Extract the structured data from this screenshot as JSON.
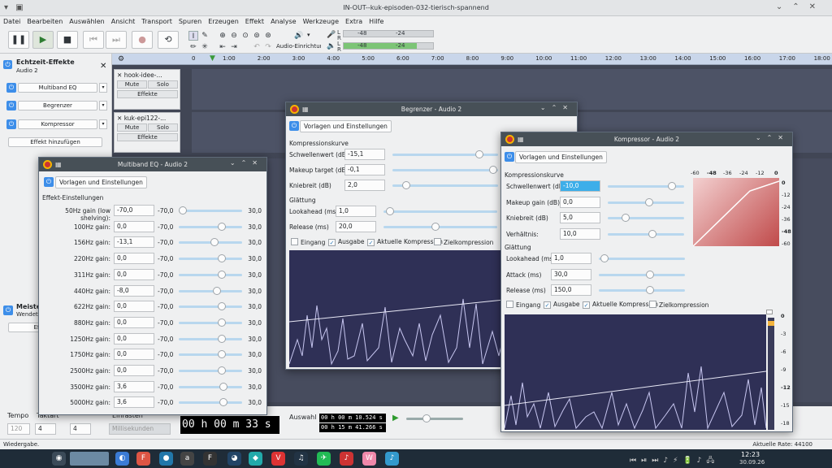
{
  "window": {
    "title": "IN-OUT--kuk-episoden-032-tierisch-spannend"
  },
  "menu": [
    "Datei",
    "Bearbeiten",
    "Auswählen",
    "Ansicht",
    "Transport",
    "Spuren",
    "Erzeugen",
    "Effekt",
    "Analyse",
    "Werkzeuge",
    "Extra",
    "Hilfe"
  ],
  "toolbar": {
    "audio_setup_label": "Audio-Einrichtung",
    "meter_rec": {
      "scale_left": "-48",
      "scale_right": "-24",
      "l": "L",
      "r": "R"
    },
    "meter_play": {
      "scale_left": "-48",
      "scale_right": "-24",
      "l": "L",
      "r": "R"
    }
  },
  "ruler": [
    "0",
    "1:00",
    "2:00",
    "3:00",
    "4:00",
    "5:00",
    "6:00",
    "7:00",
    "8:00",
    "9:00",
    "10:00",
    "11:00",
    "12:00",
    "13:00",
    "14:00",
    "15:00",
    "16:00",
    "17:00",
    "18:00"
  ],
  "tracks": [
    {
      "name": "hook-idee-...",
      "mute": "Mute",
      "solo": "Solo",
      "effects": "Effekte"
    },
    {
      "name": "kuk-epi122-...",
      "mute": "Mute",
      "solo": "Solo",
      "effects": "Effekte"
    }
  ],
  "fxpanel": {
    "title": "Echtzeit-Effekte",
    "subtitle": "Audio 2",
    "effects": [
      "Multiband EQ",
      "Begrenzer",
      "Kompressor"
    ],
    "add_label": "Effekt hinzufügen",
    "master_title": "Meiste",
    "master_sub": "Wendet",
    "master_btn": "Effe"
  },
  "selbar": {
    "tempo_label": "Tempo",
    "takt_label": "Taktart",
    "einrasten_label": "Einrasten",
    "tempo_value": "120",
    "takt_a": "4",
    "takt_b": "4",
    "snap": "Millisekunden",
    "time": "00 h 00 m 33 s",
    "auswahl_label": "Auswahl",
    "sel_start": "00 h 00 m 10.524 s",
    "sel_end": "00 h 15 m 41.266 s"
  },
  "status": {
    "left": "Wiedergabe.",
    "right": "Aktuelle Rate: 44100"
  },
  "clock": {
    "time": "12:23",
    "date": "30.09.26"
  },
  "eq_dialog": {
    "title": "Multiband EQ - Audio 2",
    "preset": "Vorlagen und Einstellungen",
    "section": "Effekt-Einstellungen",
    "params": [
      {
        "label": "50Hz gain (low shelving):",
        "value": "-70,0",
        "min": "-70,0",
        "max": "30,0",
        "pos": 0.0
      },
      {
        "label": "100Hz gain:",
        "value": "0,0",
        "min": "-70,0",
        "max": "30,0",
        "pos": 0.7
      },
      {
        "label": "156Hz gain:",
        "value": "-13,1",
        "min": "-70,0",
        "max": "30,0",
        "pos": 0.57
      },
      {
        "label": "220Hz gain:",
        "value": "0,0",
        "min": "-70,0",
        "max": "30,0",
        "pos": 0.7
      },
      {
        "label": "311Hz gain:",
        "value": "0,0",
        "min": "-70,0",
        "max": "30,0",
        "pos": 0.7
      },
      {
        "label": "440Hz gain:",
        "value": "-8,0",
        "min": "-70,0",
        "max": "30,0",
        "pos": 0.62
      },
      {
        "label": "622Hz gain:",
        "value": "0,0",
        "min": "-70,0",
        "max": "30,0",
        "pos": 0.7
      },
      {
        "label": "880Hz gain:",
        "value": "0,0",
        "min": "-70,0",
        "max": "30,0",
        "pos": 0.7
      },
      {
        "label": "1250Hz gain:",
        "value": "0,0",
        "min": "-70,0",
        "max": "30,0",
        "pos": 0.7
      },
      {
        "label": "1750Hz gain:",
        "value": "0,0",
        "min": "-70,0",
        "max": "30,0",
        "pos": 0.7
      },
      {
        "label": "2500Hz gain:",
        "value": "0,0",
        "min": "-70,0",
        "max": "30,0",
        "pos": 0.7
      },
      {
        "label": "3500Hz gain:",
        "value": "3,6",
        "min": "-70,0",
        "max": "30,0",
        "pos": 0.74
      },
      {
        "label": "5000Hz gain:",
        "value": "3,6",
        "min": "-70,0",
        "max": "30,0",
        "pos": 0.74
      }
    ]
  },
  "limiter_dialog": {
    "title": "Begrenzer - Audio 2",
    "preset": "Vorlagen und Einstellungen",
    "curve_section": "Kompressionskurve",
    "params": [
      {
        "label": "Schwellenwert (dB)",
        "value": "-15,1",
        "pos": 0.85
      },
      {
        "label": "Makeup target (dB)",
        "value": "-0,1",
        "pos": 0.99
      },
      {
        "label": "Kniebreit (dB)",
        "value": "2,0",
        "pos": 0.1
      }
    ],
    "smooth_section": "Glättung",
    "smooth": [
      {
        "label": "Lookahead (ms)",
        "value": "1,0",
        "pos": 0.02
      },
      {
        "label": "Release (ms)",
        "value": "20,0",
        "pos": 0.45
      }
    ],
    "checks": [
      {
        "label": "Eingang",
        "checked": false
      },
      {
        "label": "Ausgabe",
        "checked": true
      },
      {
        "label": "Aktuelle Kompression",
        "checked": true
      },
      {
        "label": "Zielkompression",
        "checked": false
      }
    ]
  },
  "comp_dialog": {
    "title": "Kompressor - Audio 2",
    "preset": "Vorlagen und Einstellungen",
    "curve_section": "Kompressionskurve",
    "params": [
      {
        "label": "Schwellenwert (dB)",
        "value": "-10,0",
        "pos": 0.88,
        "selected": true
      },
      {
        "label": "Makeup gain (dB)",
        "value": "0,0",
        "pos": 0.55
      },
      {
        "label": "Kniebreit (dB)",
        "value": "5,0",
        "pos": 0.2
      },
      {
        "label": "Verhältnis:",
        "value": "10,0",
        "pos": 0.6
      }
    ],
    "smooth_section": "Glättung",
    "smooth": [
      {
        "label": "Lookahead (ms)",
        "value": "1,0",
        "pos": 0.02
      },
      {
        "label": "Attack (ms)",
        "value": "30,0",
        "pos": 0.6
      },
      {
        "label": "Release (ms)",
        "value": "150,0",
        "pos": 0.6
      }
    ],
    "checks": [
      {
        "label": "Eingang",
        "checked": false
      },
      {
        "label": "Ausgabe",
        "checked": true
      },
      {
        "label": "Aktuelle Kompression",
        "checked": true
      },
      {
        "label": "Zielkompression",
        "checked": false
      }
    ],
    "curve_x_labels": [
      "-60",
      "-48",
      "-36",
      "-24",
      "-12",
      "0"
    ],
    "curve_y_labels": [
      "0",
      "-12",
      "-24",
      "-36",
      "-48",
      "-60"
    ],
    "meter_labels": [
      "0",
      "-3",
      "-6",
      "-9",
      "-12",
      "-15",
      "-18"
    ]
  }
}
